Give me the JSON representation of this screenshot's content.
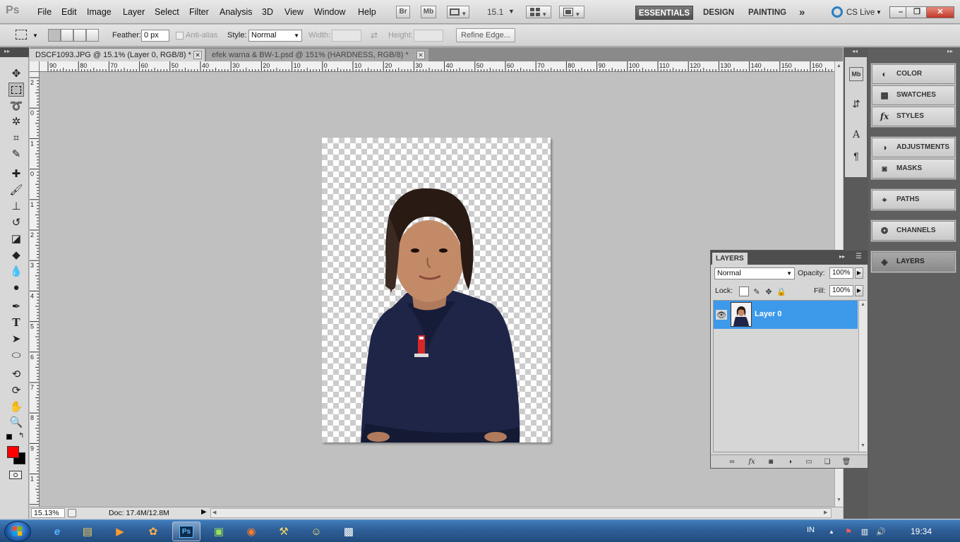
{
  "app": {
    "logo": "Ps",
    "menu": [
      "File",
      "Edit",
      "Image",
      "Layer",
      "Select",
      "Filter",
      "Analysis",
      "3D",
      "View",
      "Window",
      "Help"
    ],
    "bridge_label": "Br",
    "minibridge_label": "Mb",
    "zoom_level": "15.1",
    "workspaces": [
      "ESSENTIALS",
      "DESIGN",
      "PAINTING"
    ],
    "more_workspaces": "»",
    "cs_live": "CS Live",
    "window_controls": [
      "–",
      "❐",
      "✕"
    ]
  },
  "options": {
    "feather_label": "Feather:",
    "feather_value": "0 px",
    "antialias_label": "Anti-alias",
    "style_label": "Style:",
    "style_value": "Normal",
    "width_label": "Width:",
    "height_label": "Height:",
    "refine_edge": "Refine Edge..."
  },
  "documents": {
    "tabs": [
      {
        "title": "DSCF1093.JPG @ 15.1% (Layer 0, RGB/8) *",
        "active": true
      },
      {
        "title": "efek warna & BW-1.psd @ 151% (HARDNESS, RGB/8) *",
        "active": false
      }
    ],
    "close_glyph": "✕"
  },
  "ruler": {
    "h_labels": [
      "90",
      "80",
      "70",
      "60",
      "50",
      "40",
      "30",
      "20",
      "10",
      "0",
      "10",
      "20",
      "30",
      "40",
      "50",
      "60",
      "70",
      "80",
      "90",
      "100",
      "110",
      "120",
      "130",
      "140",
      "150",
      "160"
    ],
    "v_labels": [
      "2",
      "0",
      "1",
      "0",
      "1",
      "2",
      "3",
      "4",
      "5",
      "6",
      "7",
      "8",
      "9",
      "1",
      "1",
      "1"
    ]
  },
  "status": {
    "zoom": "15.13%",
    "doc_info": "Doc: 17.4M/12.8M"
  },
  "colors": {
    "foreground": "#ff0000",
    "background": "#000000",
    "selection_blue": "#3d99ea"
  },
  "toolbar_icons": [
    "move-icon",
    "marquee-icon",
    "lasso-icon",
    "quick-select-icon",
    "crop-icon",
    "eyedropper-icon",
    "spot-heal-icon",
    "brush-icon",
    "clone-stamp-icon",
    "history-brush-icon",
    "eraser-icon",
    "paint-bucket-icon",
    "blur-icon",
    "dodge-icon",
    "pen-icon",
    "type-icon",
    "path-select-icon",
    "shape-icon",
    "3d-rotate-icon",
    "3d-orbit-icon",
    "hand-icon",
    "zoom-icon"
  ],
  "panels": {
    "groups": [
      {
        "items": [
          {
            "label": "COLOR",
            "icon": "color-icon"
          },
          {
            "label": "SWATCHES",
            "icon": "swatches-icon"
          },
          {
            "label": "STYLES",
            "icon": "styles-icon"
          }
        ]
      },
      {
        "items": [
          {
            "label": "ADJUSTMENTS",
            "icon": "adjustments-icon"
          },
          {
            "label": "MASKS",
            "icon": "masks-icon"
          }
        ]
      },
      {
        "items": [
          {
            "label": "PATHS",
            "icon": "paths-icon"
          }
        ]
      },
      {
        "items": [
          {
            "label": "CHANNELS",
            "icon": "channels-icon"
          }
        ]
      },
      {
        "items": [
          {
            "label": "LAYERS",
            "icon": "layers-icon",
            "active": true
          }
        ]
      }
    ]
  },
  "layers": {
    "tab_title": "LAYERS",
    "blend_mode": "Normal",
    "opacity_label": "Opacity:",
    "opacity_value": "100%",
    "lock_label": "Lock:",
    "fill_label": "Fill:",
    "fill_value": "100%",
    "items": [
      {
        "name": "Layer 0",
        "visible": true,
        "selected": true
      }
    ]
  },
  "taskbar": {
    "language": "IN",
    "time": "19:34"
  }
}
